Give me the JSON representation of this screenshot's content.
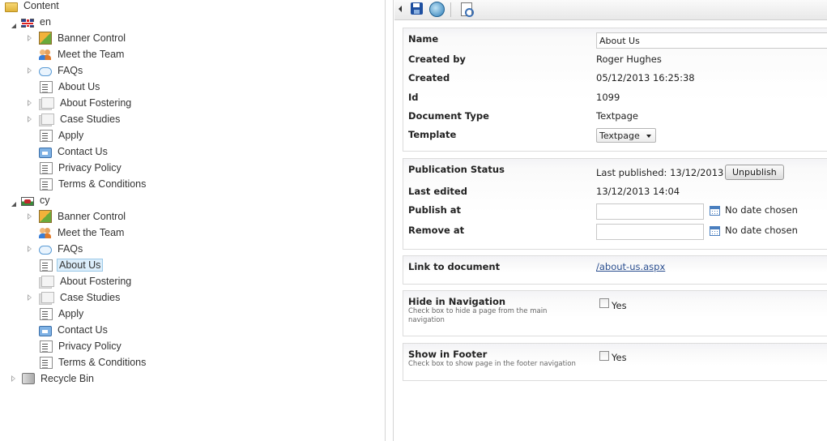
{
  "tree": {
    "root": "Content",
    "languages": [
      {
        "code": "en",
        "items": [
          "Banner Control",
          "Meet the Team",
          "FAQs",
          "About Us",
          "About Fostering",
          "Case Studies",
          "Apply",
          "Contact Us",
          "Privacy Policy",
          "Terms & Conditions"
        ]
      },
      {
        "code": "cy",
        "items": [
          "Banner Control",
          "Meet the Team",
          "FAQs",
          "About Us",
          "About Fostering",
          "Case Studies",
          "Apply",
          "Contact Us",
          "Privacy Policy",
          "Terms & Conditions"
        ]
      }
    ],
    "recycle": "Recycle Bin"
  },
  "properties": {
    "name_label": "Name",
    "name_value": "About Us",
    "created_by_label": "Created by",
    "created_by_value": "Roger Hughes",
    "created_label": "Created",
    "created_value": "05/12/2013 16:25:38",
    "id_label": "Id",
    "id_value": "1099",
    "doctype_label": "Document Type",
    "doctype_value": "Textpage",
    "template_label": "Template",
    "template_value": "Textpage"
  },
  "publication": {
    "status_label": "Publication Status",
    "last_published": "Last published: 13/12/2013",
    "unpublish_button": "Unpublish",
    "last_edited_label": "Last edited",
    "last_edited_value": "13/12/2013 14:04",
    "publish_at_label": "Publish at",
    "publish_at_status": "No date chosen",
    "remove_at_label": "Remove at",
    "remove_at_status": "No date chosen"
  },
  "link": {
    "label": "Link to document",
    "url": "/about-us.aspx"
  },
  "hide_nav": {
    "label": "Hide in Navigation",
    "desc": "Check box to hide a page from the main navigation",
    "option": "Yes"
  },
  "show_footer": {
    "label": "Show in Footer",
    "desc": "Check box to show page in the footer navigation",
    "option": "Yes"
  }
}
